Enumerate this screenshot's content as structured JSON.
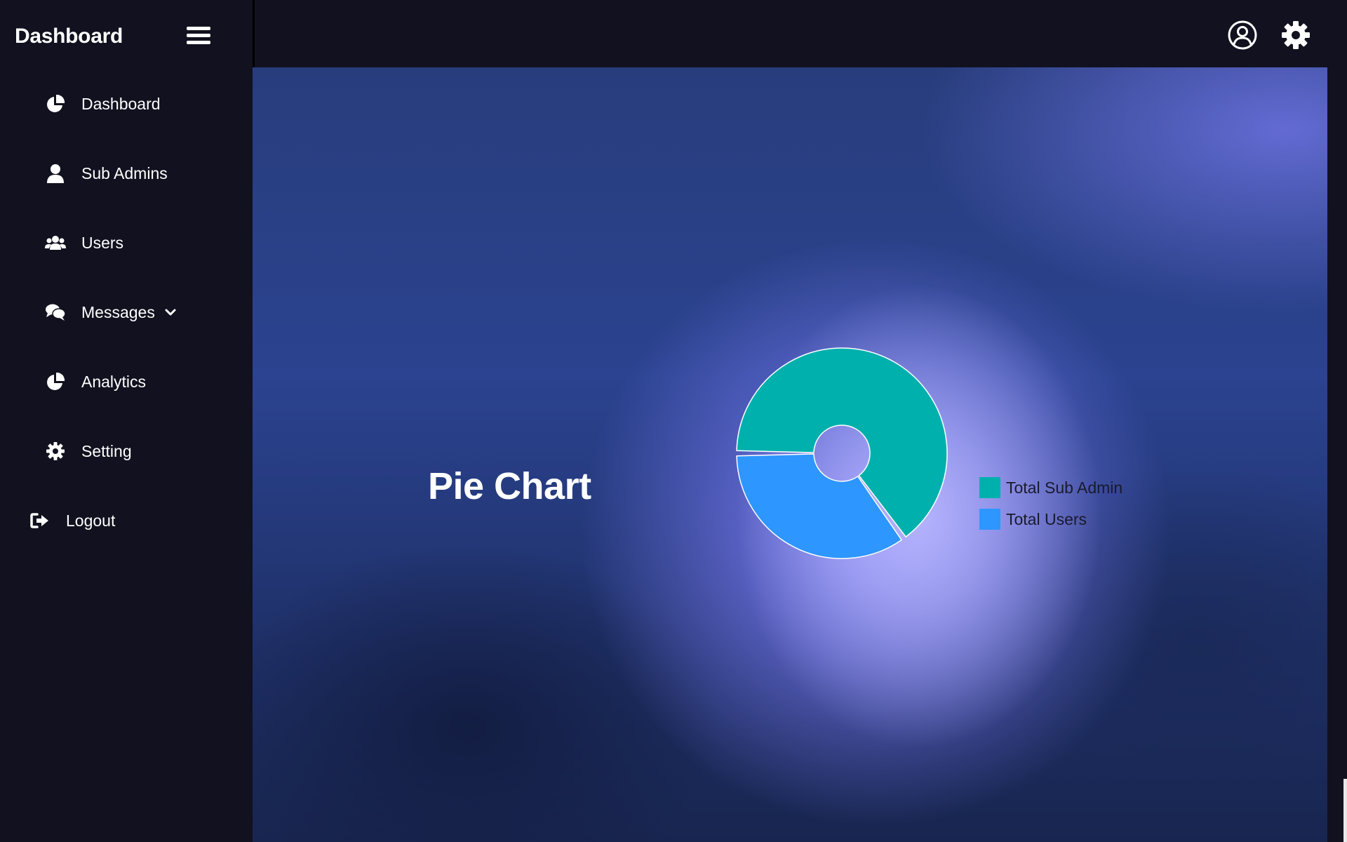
{
  "app": {
    "brand": "Dashboard"
  },
  "sidebar": {
    "items": [
      {
        "label": "Dashboard",
        "icon": "pie-chart-icon"
      },
      {
        "label": "Sub Admins",
        "icon": "user-icon"
      },
      {
        "label": "Users",
        "icon": "users-icon"
      },
      {
        "label": "Messages",
        "icon": "comments-icon",
        "has_dropdown": true
      },
      {
        "label": "Analytics",
        "icon": "pie-chart-icon"
      },
      {
        "label": "Setting",
        "icon": "gear-icon"
      }
    ],
    "logout": {
      "label": "Logout",
      "icon": "sign-out-icon"
    }
  },
  "topbar": {
    "icons": [
      "user-circle-icon",
      "gear-icon"
    ]
  },
  "main": {
    "title": "Pie Chart"
  },
  "colors": {
    "sidebar_bg": "#11111f",
    "sub_admin": "#00b0ad",
    "users": "#2e96ff"
  },
  "chart_data": {
    "type": "pie",
    "categories": [
      "Total Sub Admin",
      "Total Users"
    ],
    "values": [
      65,
      35
    ],
    "colors": [
      "#00b0ad",
      "#2e96ff"
    ],
    "legend_position": "right"
  }
}
